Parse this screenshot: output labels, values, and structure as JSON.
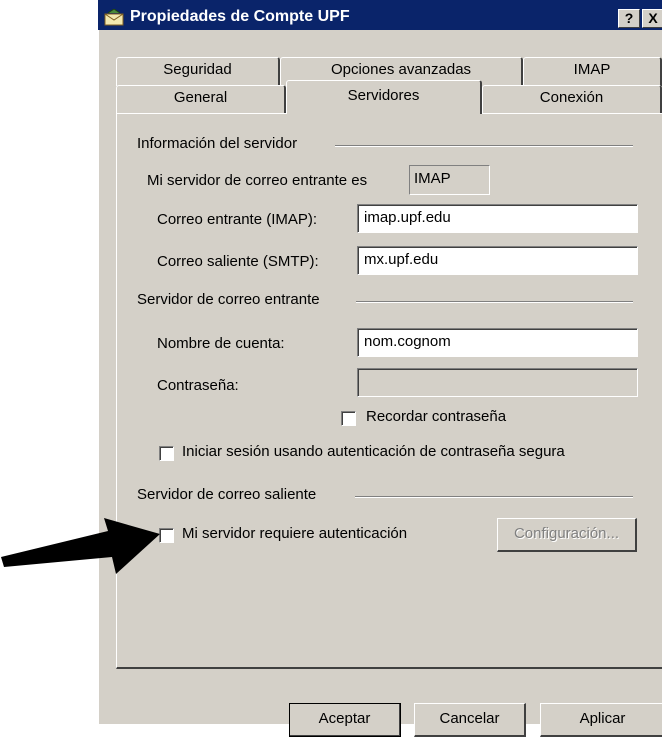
{
  "window": {
    "title": "Propiedades de Compte UPF",
    "help_btn": "?",
    "close_btn": "X"
  },
  "tabs": {
    "row_back": [
      "Seguridad",
      "Opciones avanzadas",
      "IMAP"
    ],
    "row_front": [
      "General",
      "Servidores",
      "Conexión"
    ],
    "active": "Servidores"
  },
  "server_info": {
    "title": "Información del servidor",
    "incoming_type_label": "Mi servidor de correo entrante es",
    "incoming_type_value": "IMAP",
    "incoming_label": "Correo entrante (IMAP):",
    "incoming_value": "imap.upf.edu",
    "outgoing_label": "Correo saliente (SMTP):",
    "outgoing_value": "mx.upf.edu"
  },
  "incoming_server": {
    "title": "Servidor de correo entrante",
    "account_label": "Nombre de cuenta:",
    "account_value": "nom.cognom",
    "password_label": "Contraseña:",
    "password_value": "",
    "remember_label": "Recordar contraseña",
    "remember_checked": false,
    "spa_label": "Iniciar sesión usando autenticación de contraseña segura",
    "spa_checked": false
  },
  "outgoing_server": {
    "title": "Servidor de correo saliente",
    "auth_label": "Mi servidor requiere autenticación",
    "auth_checked": false,
    "settings_button": "Configuración..."
  },
  "footer": {
    "ok": "Aceptar",
    "cancel": "Cancelar",
    "apply": "Aplicar"
  },
  "annotation": {
    "arrow_color": "#000000"
  }
}
